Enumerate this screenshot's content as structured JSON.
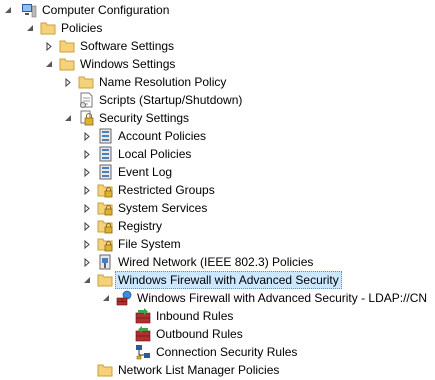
{
  "tree": {
    "computer_configuration": "Computer Configuration",
    "policies": "Policies",
    "software_settings": "Software Settings",
    "windows_settings": "Windows Settings",
    "name_resolution_policy": "Name Resolution Policy",
    "scripts": "Scripts (Startup/Shutdown)",
    "security_settings": "Security Settings",
    "account_policies": "Account Policies",
    "local_policies": "Local Policies",
    "event_log": "Event Log",
    "restricted_groups": "Restricted Groups",
    "system_services": "System Services",
    "registry": "Registry",
    "file_system": "File System",
    "wired_network": "Wired Network (IEEE 802.3) Policies",
    "windows_firewall": "Windows Firewall with Advanced Security",
    "firewall_ldap": "Windows Firewall with Advanced Security - LDAP://CN",
    "inbound_rules": "Inbound Rules",
    "outbound_rules": "Outbound Rules",
    "connection_security_rules": "Connection Security Rules",
    "network_list_manager": "Network List Manager Policies"
  },
  "colors": {
    "selection_bg": "#cce8ff",
    "selection_border": "#3399ff",
    "folder": "#f5d27a"
  }
}
